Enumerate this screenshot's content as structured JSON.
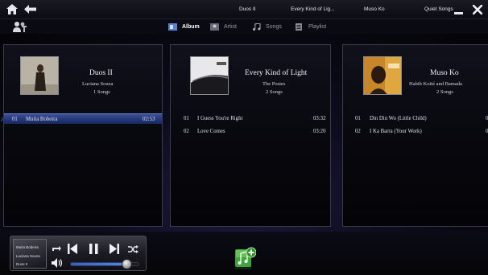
{
  "colors": {
    "accent": "#2f4a9a",
    "panel_border": "#3a3a48",
    "background": "#07070d"
  },
  "topbar": {
    "icons": [
      "home-icon",
      "back-icon",
      "minimize-icon",
      "close-icon"
    ],
    "recent": [
      "Duos II",
      "Every Kind of Lig...",
      "Muso Ko",
      "Quiet Songs"
    ]
  },
  "tabs": [
    {
      "label": "Album",
      "icon": "album-icon",
      "active": true
    },
    {
      "label": "Artist",
      "icon": "artist-icon",
      "active": false
    },
    {
      "label": "Songs",
      "icon": "music-note-icon",
      "active": false
    },
    {
      "label": "Playlist",
      "icon": "playlist-icon",
      "active": false
    }
  ],
  "albums": [
    {
      "title": "Duos II",
      "artist": "Luciana Souza",
      "count": "1 Songs",
      "tracks": [
        {
          "num": "01",
          "name": "Muita Bobeira",
          "time": "02:53",
          "selected": true
        }
      ]
    },
    {
      "title": "Every Kind of Light",
      "artist": "The Posies",
      "count": "2 Songs",
      "tracks": [
        {
          "num": "01",
          "name": "I Guess You're Right",
          "time": "03:32"
        },
        {
          "num": "02",
          "name": "Love Comes",
          "time": "03:20"
        }
      ]
    },
    {
      "title": "Muso Ko",
      "artist": "Habib Koité and Bamada",
      "count": "2 Songs",
      "tracks": [
        {
          "num": "01",
          "name": "Din Din Wo (Little Child)",
          "time": "0"
        },
        {
          "num": "02",
          "name": "I Ka Barra (Your Work)",
          "time": "0"
        }
      ]
    }
  ],
  "player": {
    "now_playing_title": "Muita Bobeira",
    "now_playing_artist": "Luciana Souza",
    "now_playing_album": "Duos II",
    "volume": 0.82,
    "controls": [
      "repeat-icon",
      "previous-icon",
      "pause-icon",
      "next-icon",
      "shuffle-icon",
      "volume-icon"
    ]
  },
  "add_music": {
    "icon": "add-music-icon"
  }
}
